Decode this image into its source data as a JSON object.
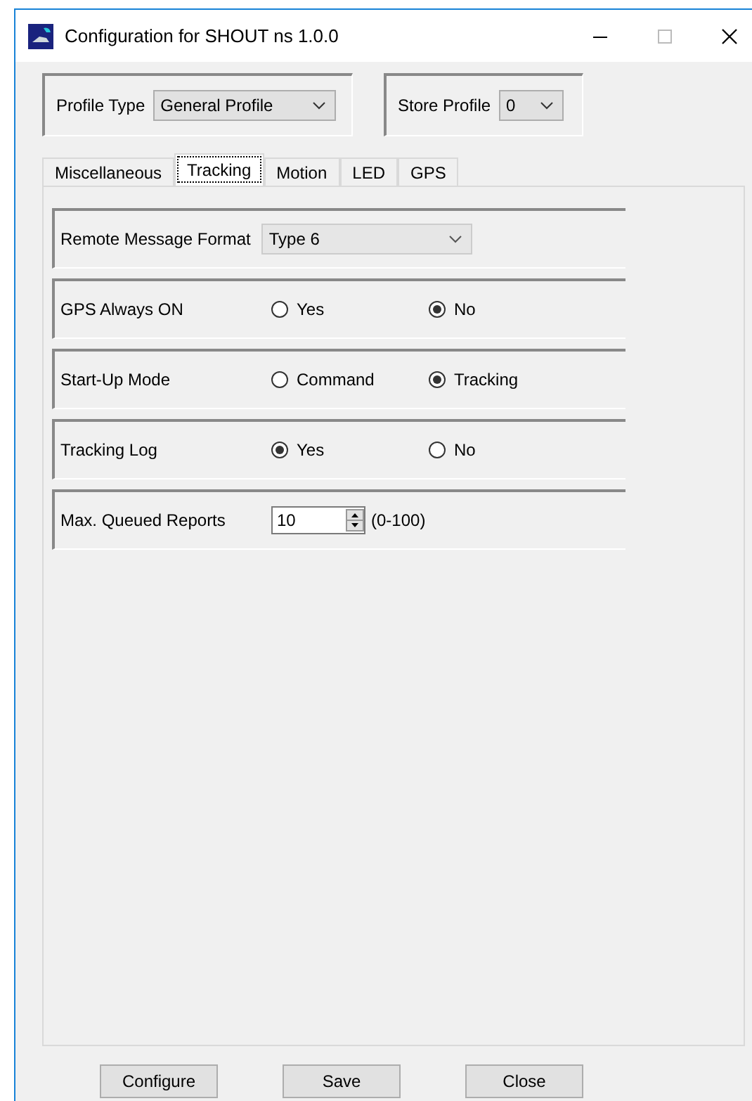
{
  "window": {
    "title": "Configuration for SHOUT ns 1.0.0"
  },
  "profile_type": {
    "label": "Profile Type",
    "value": "General Profile"
  },
  "store_profile": {
    "label": "Store Profile",
    "value": "0"
  },
  "tabs": [
    {
      "label": "Miscellaneous",
      "selected": false
    },
    {
      "label": "Tracking",
      "selected": true
    },
    {
      "label": "Motion",
      "selected": false
    },
    {
      "label": "LED",
      "selected": false
    },
    {
      "label": "GPS",
      "selected": false
    }
  ],
  "settings": [
    {
      "kind": "dropdown",
      "label": "Remote Message Format",
      "value": "Type 6"
    },
    {
      "kind": "radio",
      "label": "GPS Always ON",
      "options": [
        {
          "label": "Yes",
          "selected": false
        },
        {
          "label": "No",
          "selected": true
        }
      ]
    },
    {
      "kind": "radio",
      "label": "Start-Up Mode",
      "options": [
        {
          "label": "Command",
          "selected": false
        },
        {
          "label": "Tracking",
          "selected": true
        }
      ]
    },
    {
      "kind": "radio",
      "label": "Tracking Log",
      "options": [
        {
          "label": "Yes",
          "selected": true
        },
        {
          "label": "No",
          "selected": false
        }
      ]
    },
    {
      "kind": "spinner",
      "label": "Max. Queued Reports",
      "value": "10",
      "range": "(0-100)"
    }
  ],
  "buttons": [
    "Configure",
    "Save",
    "Close"
  ]
}
